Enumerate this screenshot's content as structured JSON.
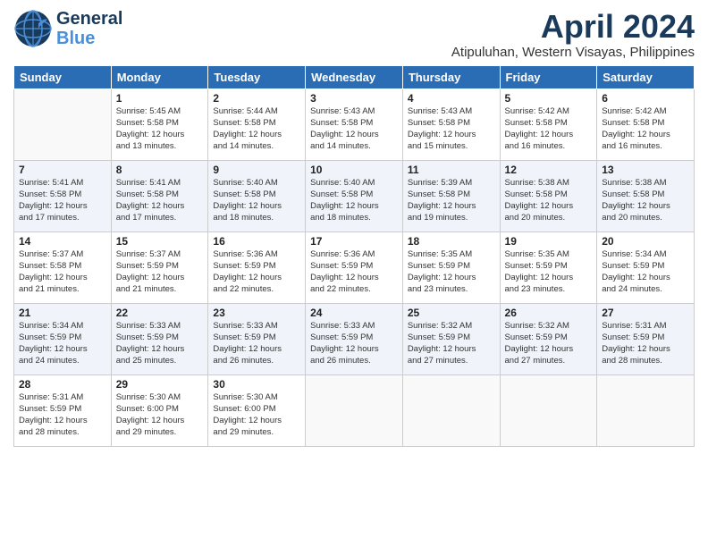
{
  "header": {
    "logo_general": "General",
    "logo_blue": "Blue",
    "month_title": "April 2024",
    "subtitle": "Atipuluhan, Western Visayas, Philippines"
  },
  "weekdays": [
    "Sunday",
    "Monday",
    "Tuesday",
    "Wednesday",
    "Thursday",
    "Friday",
    "Saturday"
  ],
  "weeks": [
    [
      {
        "day": "",
        "sunrise": "",
        "sunset": "",
        "daylight": ""
      },
      {
        "day": "1",
        "sunrise": "Sunrise: 5:45 AM",
        "sunset": "Sunset: 5:58 PM",
        "daylight": "Daylight: 12 hours and 13 minutes."
      },
      {
        "day": "2",
        "sunrise": "Sunrise: 5:44 AM",
        "sunset": "Sunset: 5:58 PM",
        "daylight": "Daylight: 12 hours and 14 minutes."
      },
      {
        "day": "3",
        "sunrise": "Sunrise: 5:43 AM",
        "sunset": "Sunset: 5:58 PM",
        "daylight": "Daylight: 12 hours and 14 minutes."
      },
      {
        "day": "4",
        "sunrise": "Sunrise: 5:43 AM",
        "sunset": "Sunset: 5:58 PM",
        "daylight": "Daylight: 12 hours and 15 minutes."
      },
      {
        "day": "5",
        "sunrise": "Sunrise: 5:42 AM",
        "sunset": "Sunset: 5:58 PM",
        "daylight": "Daylight: 12 hours and 16 minutes."
      },
      {
        "day": "6",
        "sunrise": "Sunrise: 5:42 AM",
        "sunset": "Sunset: 5:58 PM",
        "daylight": "Daylight: 12 hours and 16 minutes."
      }
    ],
    [
      {
        "day": "7",
        "sunrise": "Sunrise: 5:41 AM",
        "sunset": "Sunset: 5:58 PM",
        "daylight": "Daylight: 12 hours and 17 minutes."
      },
      {
        "day": "8",
        "sunrise": "Sunrise: 5:41 AM",
        "sunset": "Sunset: 5:58 PM",
        "daylight": "Daylight: 12 hours and 17 minutes."
      },
      {
        "day": "9",
        "sunrise": "Sunrise: 5:40 AM",
        "sunset": "Sunset: 5:58 PM",
        "daylight": "Daylight: 12 hours and 18 minutes."
      },
      {
        "day": "10",
        "sunrise": "Sunrise: 5:40 AM",
        "sunset": "Sunset: 5:58 PM",
        "daylight": "Daylight: 12 hours and 18 minutes."
      },
      {
        "day": "11",
        "sunrise": "Sunrise: 5:39 AM",
        "sunset": "Sunset: 5:58 PM",
        "daylight": "Daylight: 12 hours and 19 minutes."
      },
      {
        "day": "12",
        "sunrise": "Sunrise: 5:38 AM",
        "sunset": "Sunset: 5:58 PM",
        "daylight": "Daylight: 12 hours and 20 minutes."
      },
      {
        "day": "13",
        "sunrise": "Sunrise: 5:38 AM",
        "sunset": "Sunset: 5:58 PM",
        "daylight": "Daylight: 12 hours and 20 minutes."
      }
    ],
    [
      {
        "day": "14",
        "sunrise": "Sunrise: 5:37 AM",
        "sunset": "Sunset: 5:58 PM",
        "daylight": "Daylight: 12 hours and 21 minutes."
      },
      {
        "day": "15",
        "sunrise": "Sunrise: 5:37 AM",
        "sunset": "Sunset: 5:59 PM",
        "daylight": "Daylight: 12 hours and 21 minutes."
      },
      {
        "day": "16",
        "sunrise": "Sunrise: 5:36 AM",
        "sunset": "Sunset: 5:59 PM",
        "daylight": "Daylight: 12 hours and 22 minutes."
      },
      {
        "day": "17",
        "sunrise": "Sunrise: 5:36 AM",
        "sunset": "Sunset: 5:59 PM",
        "daylight": "Daylight: 12 hours and 22 minutes."
      },
      {
        "day": "18",
        "sunrise": "Sunrise: 5:35 AM",
        "sunset": "Sunset: 5:59 PM",
        "daylight": "Daylight: 12 hours and 23 minutes."
      },
      {
        "day": "19",
        "sunrise": "Sunrise: 5:35 AM",
        "sunset": "Sunset: 5:59 PM",
        "daylight": "Daylight: 12 hours and 23 minutes."
      },
      {
        "day": "20",
        "sunrise": "Sunrise: 5:34 AM",
        "sunset": "Sunset: 5:59 PM",
        "daylight": "Daylight: 12 hours and 24 minutes."
      }
    ],
    [
      {
        "day": "21",
        "sunrise": "Sunrise: 5:34 AM",
        "sunset": "Sunset: 5:59 PM",
        "daylight": "Daylight: 12 hours and 24 minutes."
      },
      {
        "day": "22",
        "sunrise": "Sunrise: 5:33 AM",
        "sunset": "Sunset: 5:59 PM",
        "daylight": "Daylight: 12 hours and 25 minutes."
      },
      {
        "day": "23",
        "sunrise": "Sunrise: 5:33 AM",
        "sunset": "Sunset: 5:59 PM",
        "daylight": "Daylight: 12 hours and 26 minutes."
      },
      {
        "day": "24",
        "sunrise": "Sunrise: 5:33 AM",
        "sunset": "Sunset: 5:59 PM",
        "daylight": "Daylight: 12 hours and 26 minutes."
      },
      {
        "day": "25",
        "sunrise": "Sunrise: 5:32 AM",
        "sunset": "Sunset: 5:59 PM",
        "daylight": "Daylight: 12 hours and 27 minutes."
      },
      {
        "day": "26",
        "sunrise": "Sunrise: 5:32 AM",
        "sunset": "Sunset: 5:59 PM",
        "daylight": "Daylight: 12 hours and 27 minutes."
      },
      {
        "day": "27",
        "sunrise": "Sunrise: 5:31 AM",
        "sunset": "Sunset: 5:59 PM",
        "daylight": "Daylight: 12 hours and 28 minutes."
      }
    ],
    [
      {
        "day": "28",
        "sunrise": "Sunrise: 5:31 AM",
        "sunset": "Sunset: 5:59 PM",
        "daylight": "Daylight: 12 hours and 28 minutes."
      },
      {
        "day": "29",
        "sunrise": "Sunrise: 5:30 AM",
        "sunset": "Sunset: 6:00 PM",
        "daylight": "Daylight: 12 hours and 29 minutes."
      },
      {
        "day": "30",
        "sunrise": "Sunrise: 5:30 AM",
        "sunset": "Sunset: 6:00 PM",
        "daylight": "Daylight: 12 hours and 29 minutes."
      },
      {
        "day": "",
        "sunrise": "",
        "sunset": "",
        "daylight": ""
      },
      {
        "day": "",
        "sunrise": "",
        "sunset": "",
        "daylight": ""
      },
      {
        "day": "",
        "sunrise": "",
        "sunset": "",
        "daylight": ""
      },
      {
        "day": "",
        "sunrise": "",
        "sunset": "",
        "daylight": ""
      }
    ]
  ]
}
